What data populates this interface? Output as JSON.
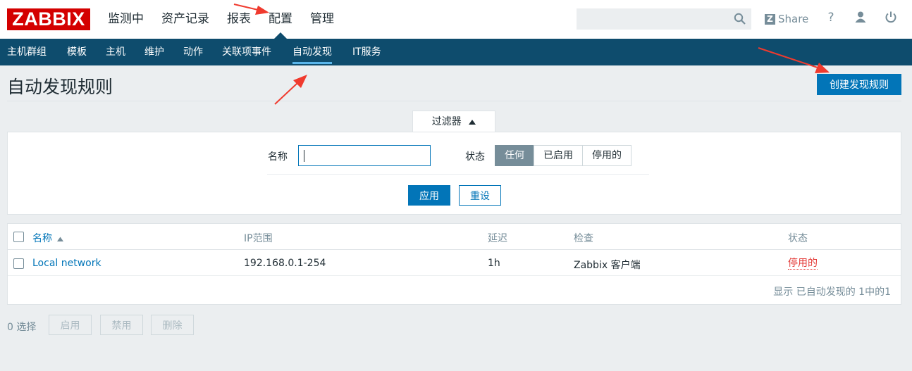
{
  "header": {
    "logo": "ZABBIX",
    "nav": [
      "监测中",
      "资产记录",
      "报表",
      "配置",
      "管理"
    ],
    "active_nav": "配置",
    "search_value": "",
    "share_label": "Share",
    "help_label": "?"
  },
  "subnav": {
    "items": [
      "主机群组",
      "模板",
      "主机",
      "维护",
      "动作",
      "关联项事件",
      "自动发现",
      "IT服务"
    ],
    "active": "自动发现"
  },
  "page": {
    "title": "自动发现规则",
    "create_button": "创建发现规则"
  },
  "filter": {
    "tab_label": "过滤器",
    "name_label": "名称",
    "name_value": "",
    "status_label": "状态",
    "status_options": [
      "任何",
      "已启用",
      "停用的"
    ],
    "status_selected": "任何",
    "apply_label": "应用",
    "reset_label": "重设"
  },
  "table": {
    "columns": [
      "名称",
      "IP范围",
      "延迟",
      "检查",
      "状态"
    ],
    "sort_column": "名称",
    "rows": [
      {
        "name": "Local network",
        "ip_range": "192.168.0.1-254",
        "delay": "1h",
        "checks": "Zabbix 客户端",
        "status": "停用的"
      }
    ],
    "footer": "显示 已自动发现的 1中的1"
  },
  "actions": {
    "selected": "0 选择",
    "buttons": [
      "启用",
      "禁用",
      "删除"
    ]
  },
  "colors": {
    "brand_red": "#d40000",
    "subnav_bg": "#0e4c6d",
    "primary": "#0275b8",
    "disabled_status": "#e33734",
    "annotation_arrow": "#f03a2e"
  }
}
